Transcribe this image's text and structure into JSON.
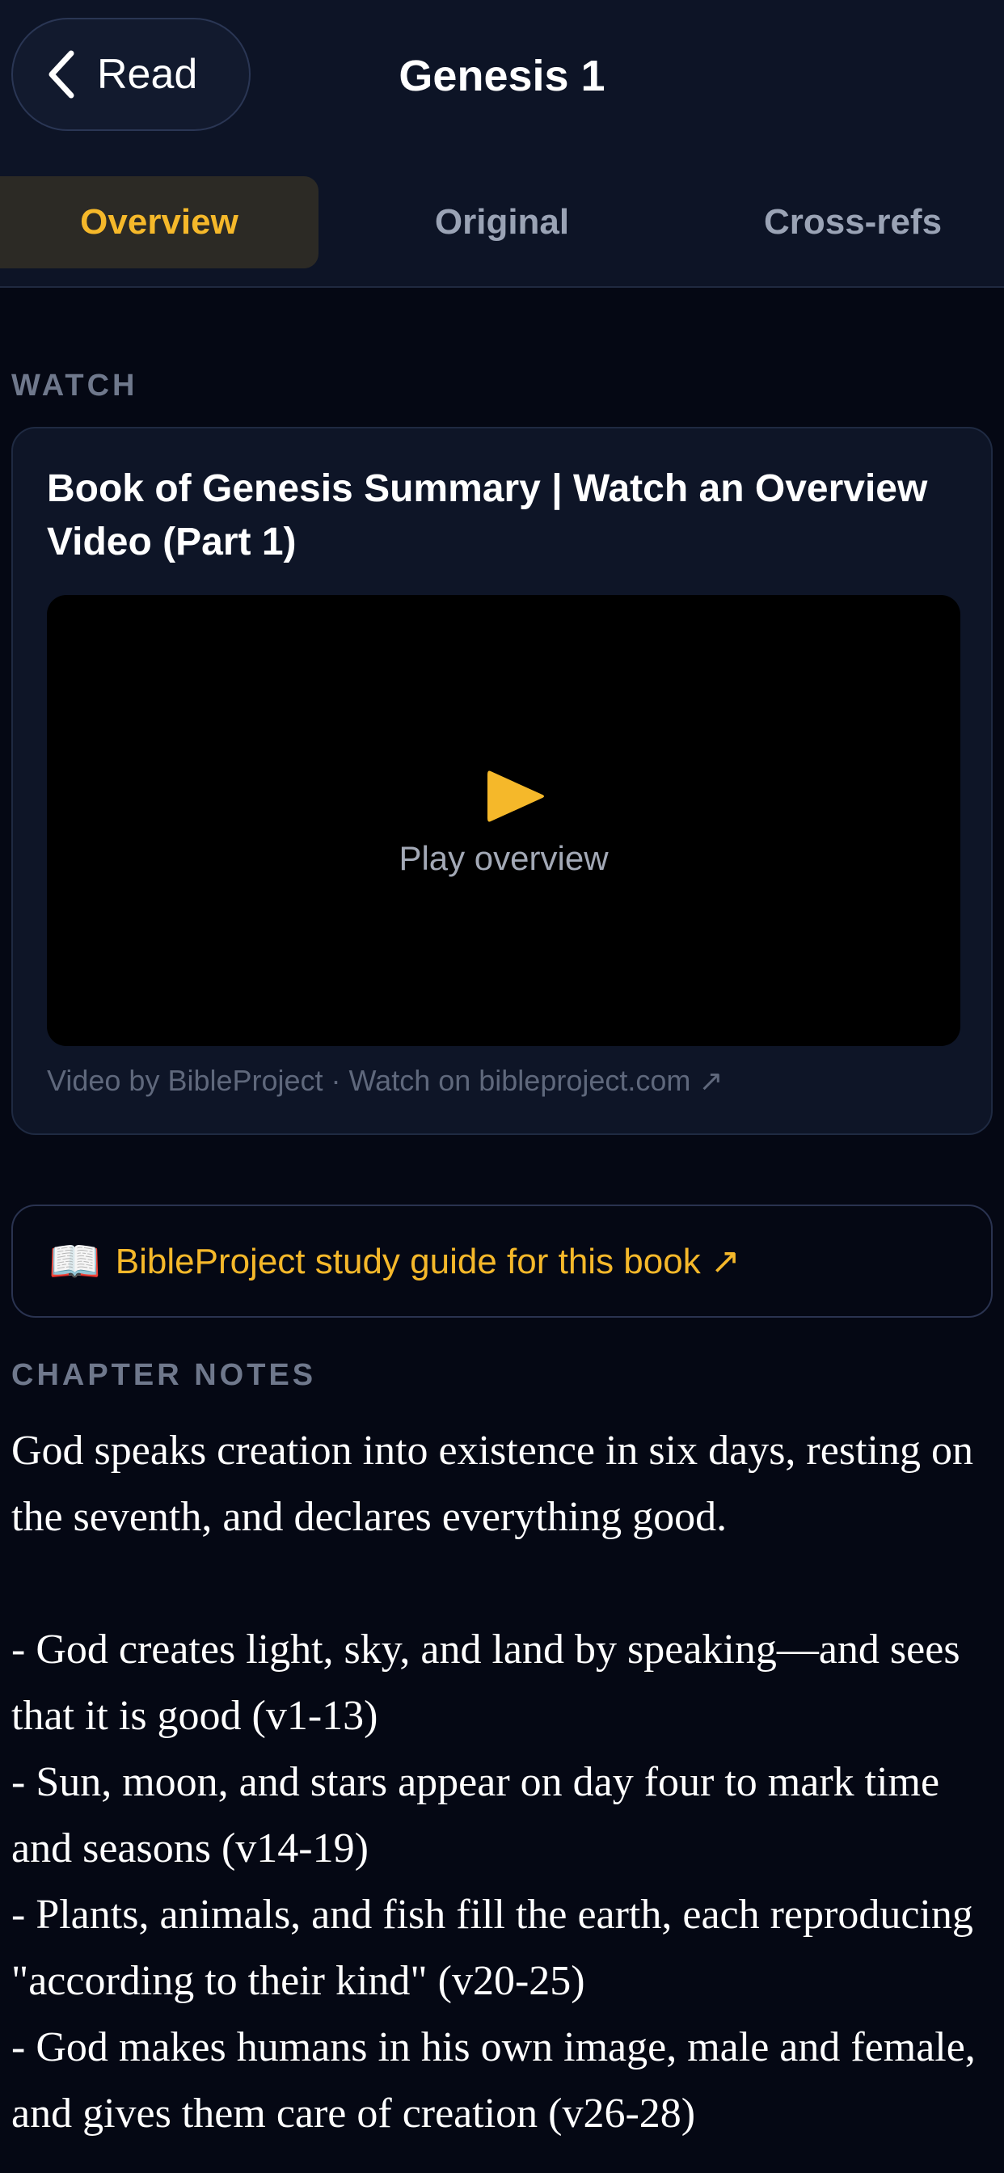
{
  "header": {
    "back_label": "Read",
    "title": "Genesis 1"
  },
  "tabs": [
    {
      "label": "Overview",
      "active": true
    },
    {
      "label": "Original",
      "active": false
    },
    {
      "label": "Cross-refs",
      "active": false
    }
  ],
  "watch": {
    "section_label": "WATCH",
    "video_title": "Book of Genesis Summary | Watch an Overview Video (Part 1)",
    "play_label": "Play overview",
    "credit": "Video by BibleProject · Watch on bibleproject.com ↗"
  },
  "study_guide": {
    "icon": "📖",
    "label": "BibleProject study guide for this book ↗"
  },
  "notes": {
    "section_label": "CHAPTER NOTES",
    "summary": "God speaks creation into existence in six days, resting on the seventh, and declares everything good.",
    "bullets": [
      "- God creates light, sky, and land by speaking—and sees that it is good (v1-13)",
      "- Sun, moon, and stars appear on day four to mark time and seasons (v14-19)",
      "- Plants, animals, and fish fill the earth, each reproducing \"according to their kind\" (v20-25)",
      "- God makes humans in his own image, male and female, and gives them care of creation (v26-28)"
    ]
  },
  "colors": {
    "accent": "#f5b82a",
    "background": "#050814",
    "header": "#0d1426",
    "card": "#0e1527"
  }
}
